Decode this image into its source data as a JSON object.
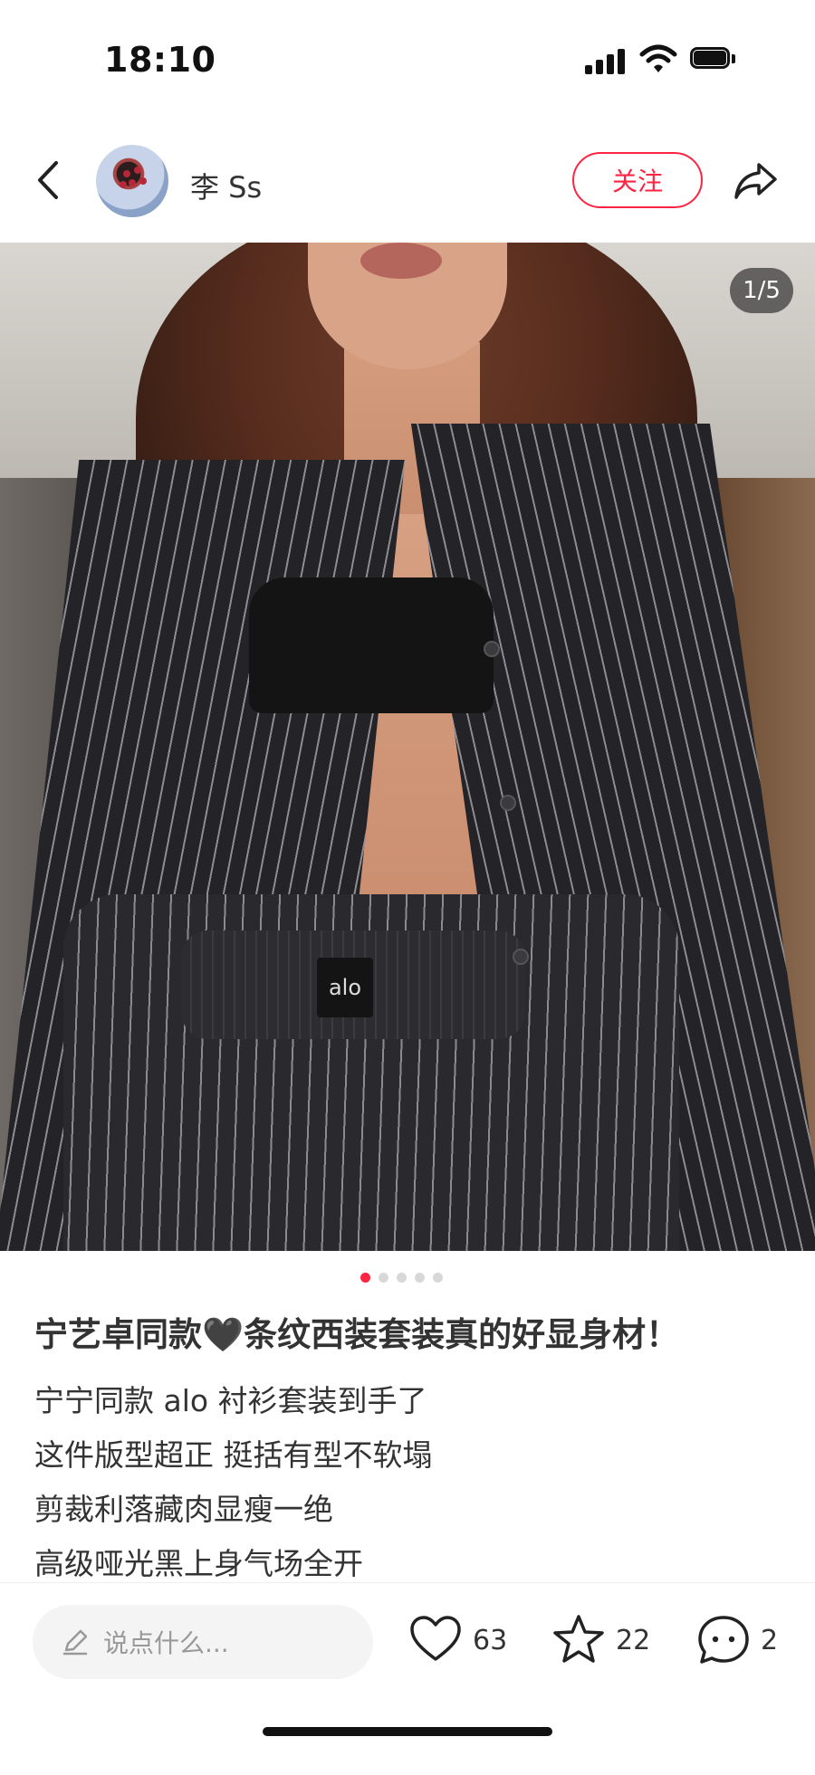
{
  "status_bar": {
    "time": "18:10"
  },
  "header": {
    "username": "李 Ss",
    "follow_label": "关注"
  },
  "photo": {
    "counter": "1/5",
    "brand_label": "alo",
    "page_count": 5,
    "current_page": 1
  },
  "post": {
    "title": "宁艺卓同款🖤条纹西装套装真的好显身材！",
    "lines": [
      "宁宁同款 alo 衬衫套装到手了",
      "这件版型超正 挺括有型不软塌",
      "剪裁利落藏肉显瘦一绝",
      "高级哑光黑上身气场全开"
    ]
  },
  "bottom_bar": {
    "comment_placeholder": "说点什么...",
    "likes": "63",
    "collects": "22",
    "comments": "2"
  },
  "colors": {
    "accent": "#ff2442"
  }
}
